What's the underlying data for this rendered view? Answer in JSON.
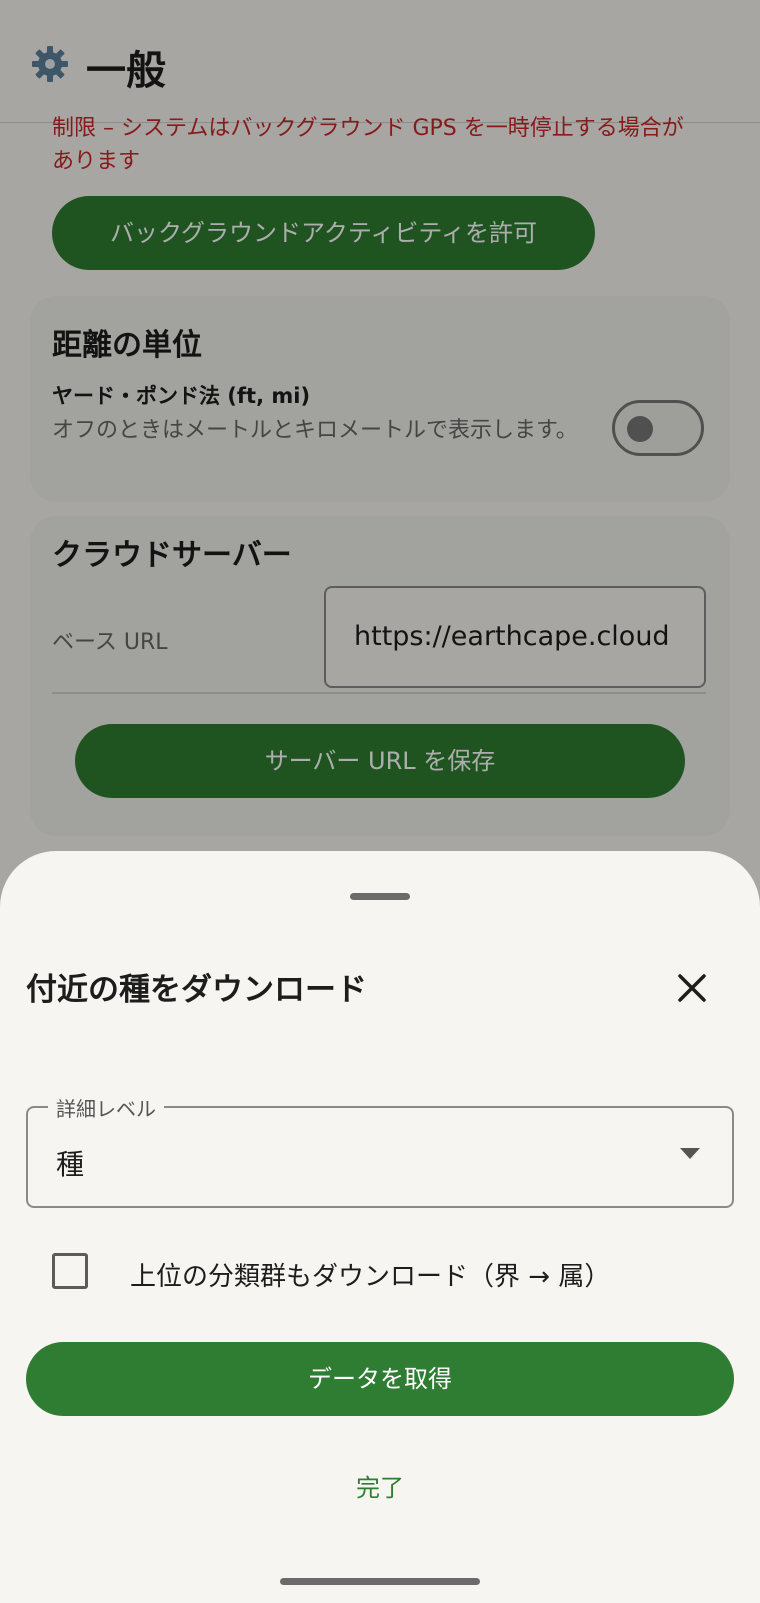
{
  "colors": {
    "primary": "#2e7d32",
    "warning": "#c62828",
    "background": "#f6f5f1",
    "scrim": "rgba(0,0,0,0.32)"
  },
  "appbar": {
    "icon": "gear-icon",
    "title": "一般"
  },
  "background_activity": {
    "warning_text": "制限 – システムはバックグラウンド GPS を一時停止する場合があります",
    "button_label": "バックグラウンドアクティビティを許可"
  },
  "distance_units": {
    "title": "距離の単位",
    "option_label": "ヤード・ポンド法 (ft, mi)",
    "option_description": "オフのときはメートルとキロメートルで表示します。",
    "toggle_on": false
  },
  "cloud_server": {
    "title": "クラウドサーバー",
    "base_url_label": "ベース URL",
    "base_url_value": "https://earthcape.cloud",
    "save_button_label": "サーバー URL を保存"
  },
  "sheet": {
    "title": "付近の種をダウンロード",
    "close_icon": "close-icon",
    "detail_level_label": "詳細レベル",
    "detail_level_value": "種",
    "higher_taxa_checkbox_label": "上位の分類群もダウンロード（界 → 属）",
    "higher_taxa_checked": false,
    "fetch_button_label": "データを取得",
    "done_label": "完了"
  }
}
